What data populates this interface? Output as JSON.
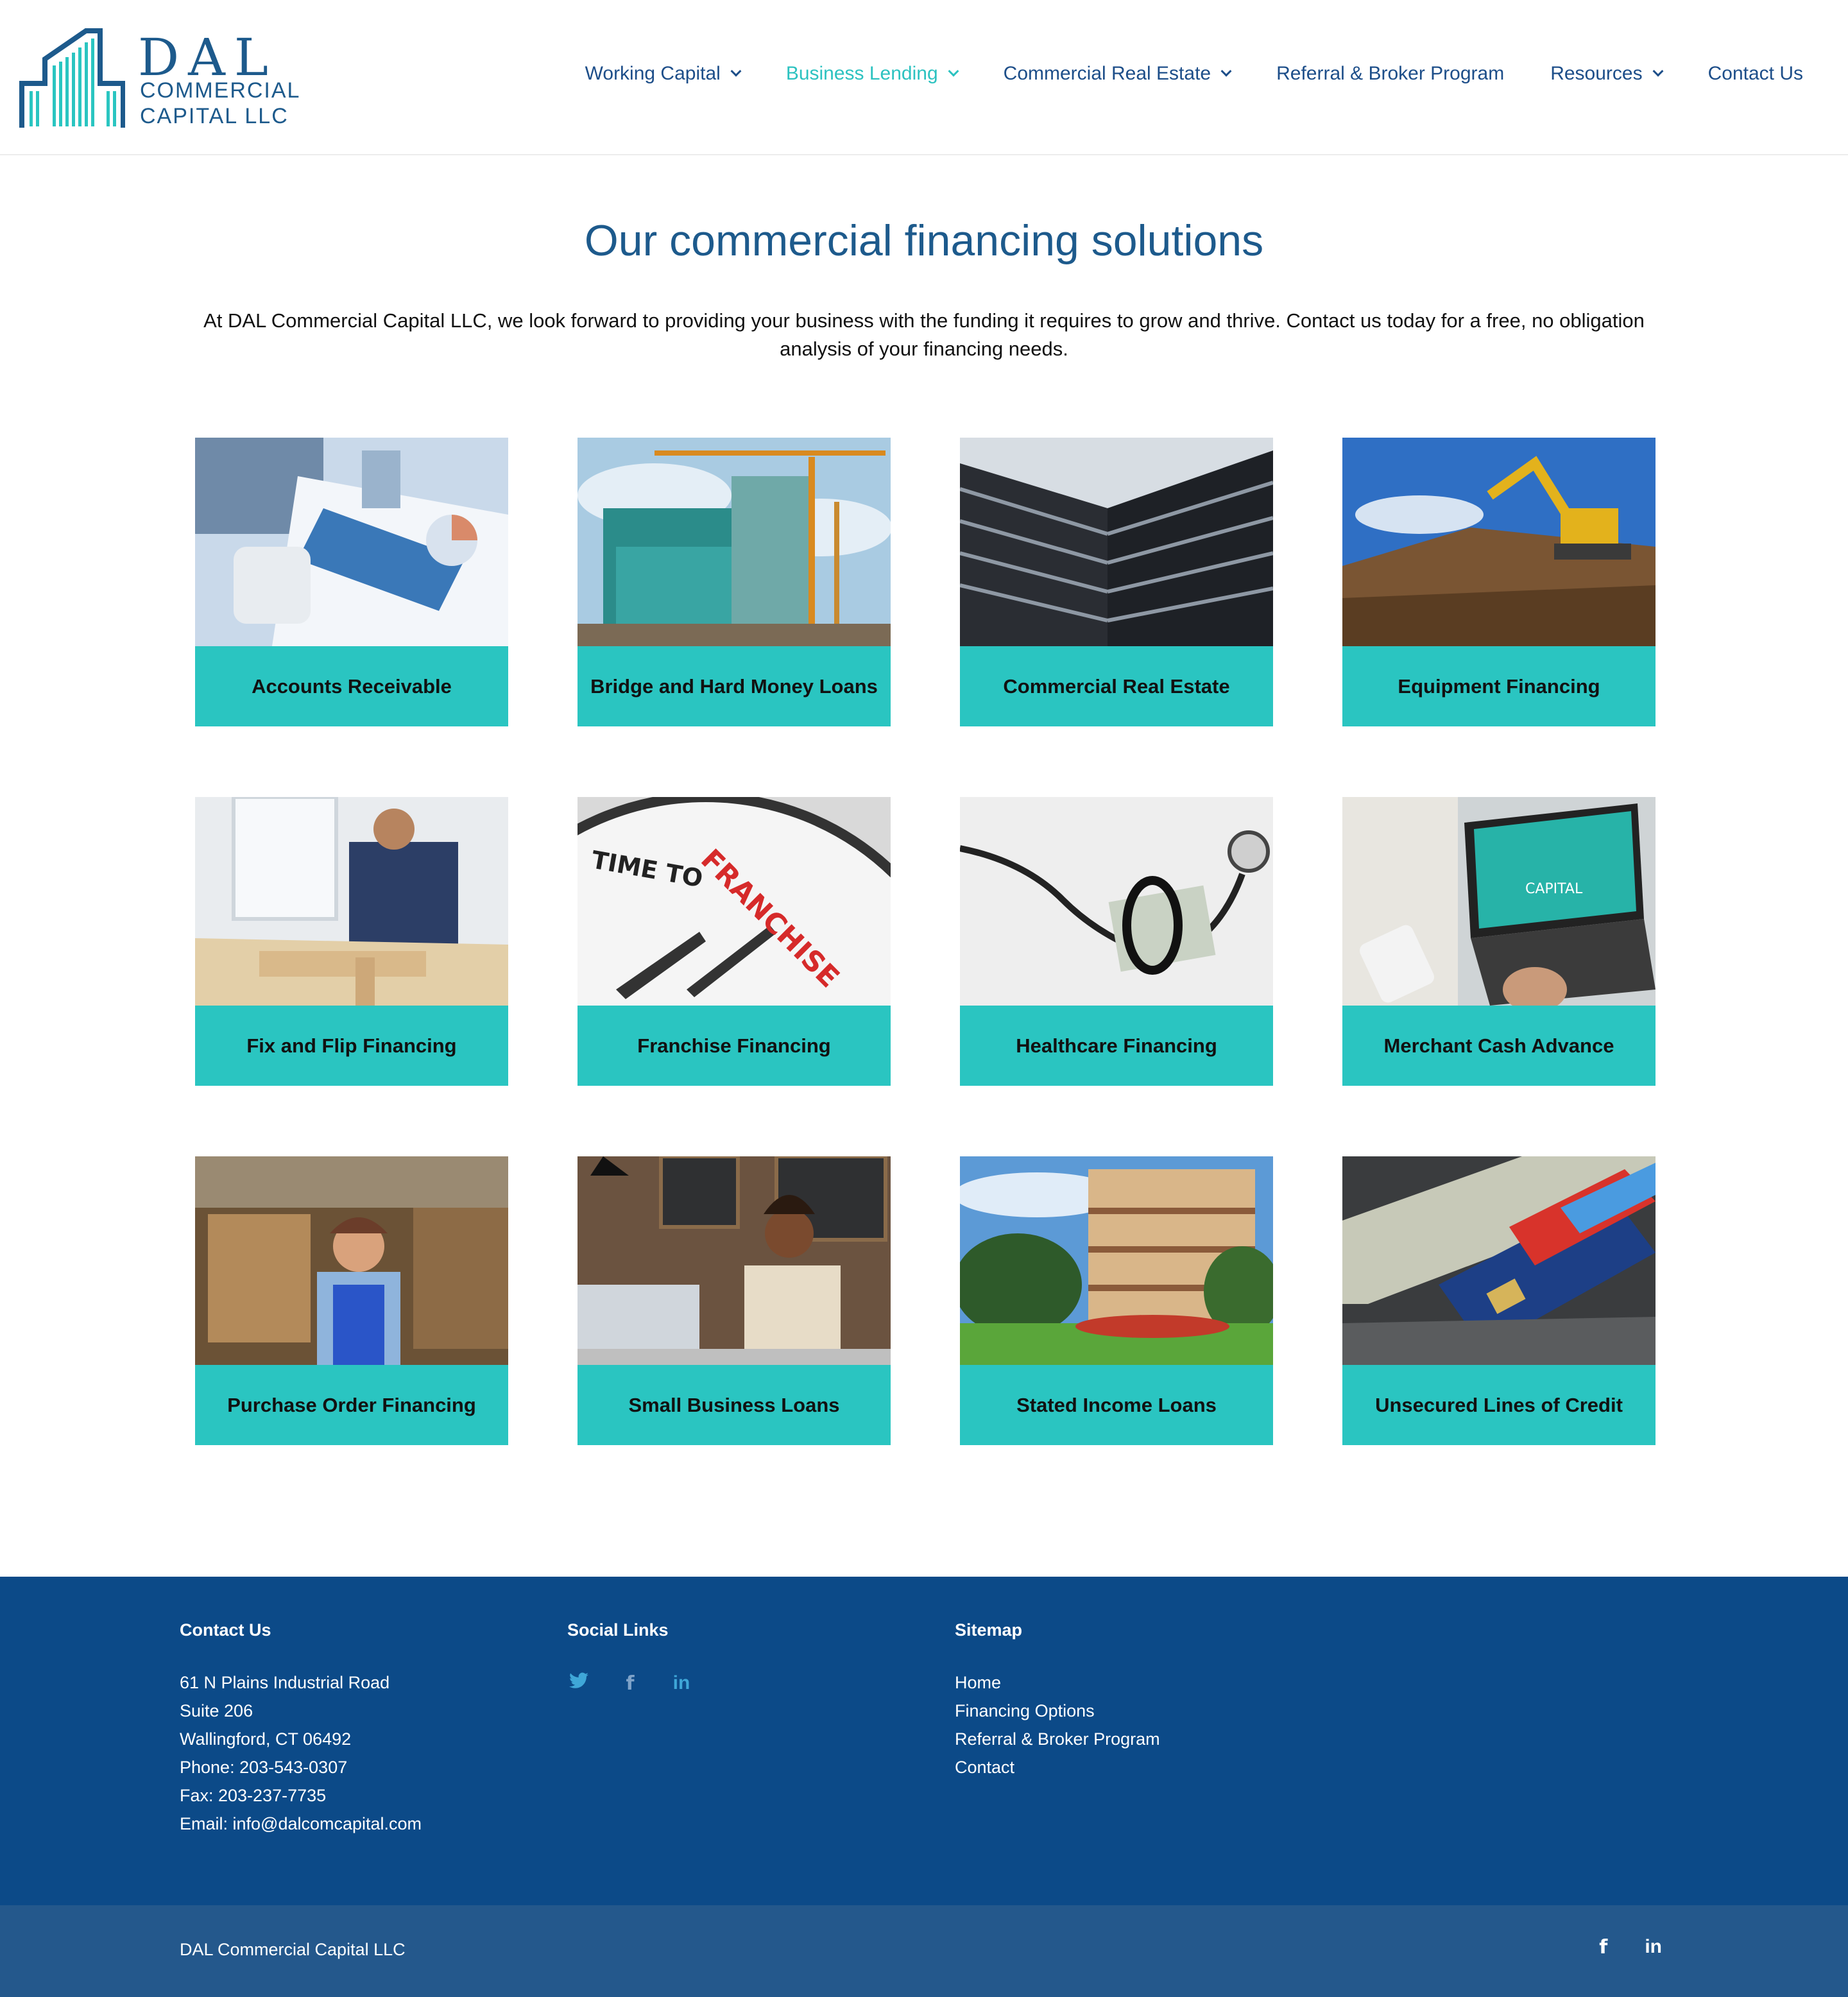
{
  "brand": {
    "name_top": "DAL",
    "name_line1": "COMMERCIAL",
    "name_line2": "CAPITAL LLC",
    "colors": {
      "primary": "#1d5a8c",
      "accent": "#2ac5c1",
      "footer": "#0c4a88",
      "bottom_bar": "#24588c"
    }
  },
  "nav": [
    {
      "label": "Working Capital",
      "dropdown": true,
      "active": false
    },
    {
      "label": "Business Lending",
      "dropdown": true,
      "active": true
    },
    {
      "label": "Commercial Real Estate",
      "dropdown": true,
      "active": false
    },
    {
      "label": "Referral & Broker Program",
      "dropdown": false,
      "active": false
    },
    {
      "label": "Resources",
      "dropdown": true,
      "active": false
    },
    {
      "label": "Contact Us",
      "dropdown": false,
      "active": false
    }
  ],
  "main": {
    "title": "Our commercial financing solutions",
    "intro": "At DAL Commercial Capital LLC, we look forward to providing your business with the funding it requires to grow and thrive. Contact us today for a free, no obligation analysis of your financing needs."
  },
  "solutions": [
    {
      "label": "Accounts Receivable",
      "image": "accounting-photo"
    },
    {
      "label": "Bridge and Hard Money Loans",
      "image": "construction-cranes-photo"
    },
    {
      "label": "Commercial Real Estate",
      "image": "office-tower-photo"
    },
    {
      "label": "Equipment Financing",
      "image": "excavator-photo"
    },
    {
      "label": "Fix and Flip Financing",
      "image": "carpenter-photo"
    },
    {
      "label": "Franchise Financing",
      "image": "franchise-clock-photo"
    },
    {
      "label": "Healthcare Financing",
      "image": "stethoscope-money-photo"
    },
    {
      "label": "Merchant Cash Advance",
      "image": "laptop-capital-photo"
    },
    {
      "label": "Purchase Order Financing",
      "image": "warehouse-worker-photo"
    },
    {
      "label": "Small Business Loans",
      "image": "cafe-owner-photo"
    },
    {
      "label": "Stated Income Loans",
      "image": "apartment-building-photo"
    },
    {
      "label": "Unsecured Lines of Credit",
      "image": "credit-cards-photo"
    }
  ],
  "footer": {
    "contact": {
      "heading": "Contact Us",
      "lines": [
        "61 N Plains Industrial Road",
        "Suite 206",
        "Wallingford, CT 06492",
        "Phone: 203-543-0307",
        "Fax: 203-237-7735",
        "Email: info@dalcomcapital.com"
      ]
    },
    "social": {
      "heading": "Social Links",
      "icons": [
        "twitter-icon",
        "facebook-icon",
        "linkedin-icon"
      ]
    },
    "sitemap": {
      "heading": "Sitemap",
      "links": [
        "Home",
        "Financing Options",
        "Referral & Broker Program",
        "Contact"
      ]
    },
    "copyright": "DAL Commercial Capital LLC",
    "bottom_icons": [
      "facebook-icon",
      "linkedin-icon"
    ]
  }
}
